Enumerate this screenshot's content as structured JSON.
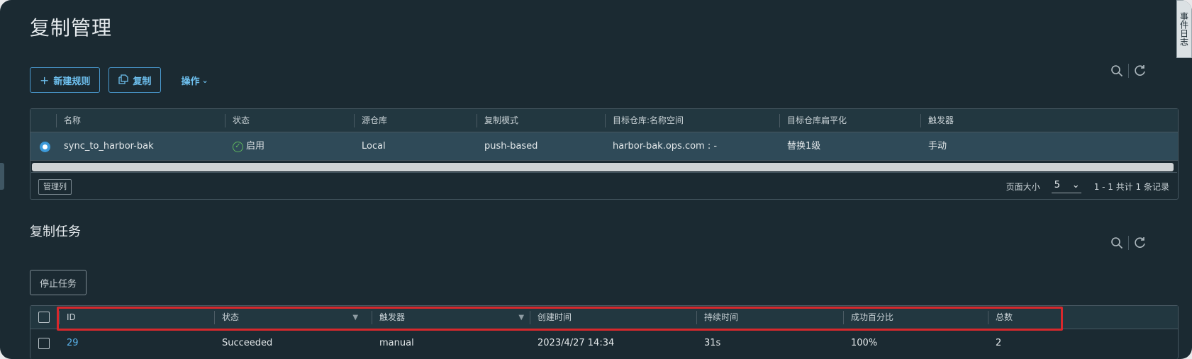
{
  "event_tab": "事件日志",
  "page_title": "复制管理",
  "toolbar": {
    "new_rule": "新建规则",
    "copy": "复制",
    "actions": "操作"
  },
  "rules_table": {
    "columns": [
      "名称",
      "状态",
      "源仓库",
      "复制模式",
      "目标仓库:名称空间",
      "目标仓库扁平化",
      "触发器"
    ],
    "rows": [
      {
        "name": "sync_to_harbor-bak",
        "status": "启用",
        "source": "Local",
        "mode": "push-based",
        "target": "harbor-bak.ops.com : -",
        "flatten": "替换1级",
        "trigger": "手动"
      }
    ],
    "manage_columns": "管理列",
    "page_size_label": "页面大小",
    "page_size": "5",
    "summary": "1 - 1 共计 1 条记录"
  },
  "tasks": {
    "title": "复制任务",
    "stop_button": "停止任务",
    "columns": [
      "ID",
      "状态",
      "触发器",
      "创建时间",
      "持续时间",
      "成功百分比",
      "总数"
    ],
    "rows": [
      {
        "id": "29",
        "status": "Succeeded",
        "trigger": "manual",
        "created": "2023/4/27 14:34",
        "duration": "31s",
        "success": "100%",
        "total": "2"
      }
    ]
  },
  "colors": {
    "background": "#1b2a32",
    "accent": "#6ec0ef",
    "highlight": "#d8282c",
    "success": "#5fb75e"
  }
}
